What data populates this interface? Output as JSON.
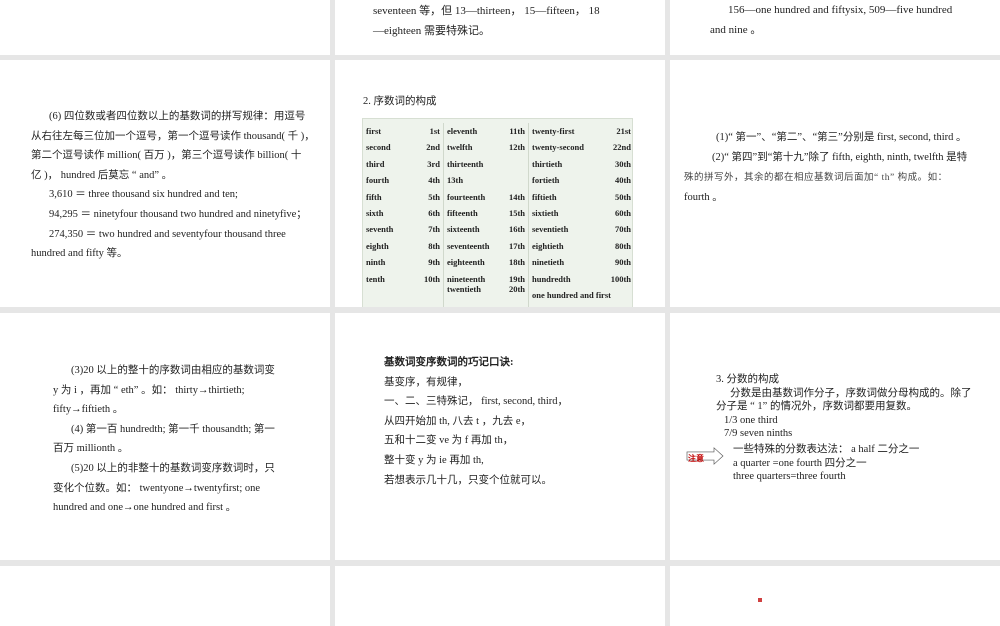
{
  "slide_top_middle": {
    "lines": [
      "seventeen 等，但 13—thirteen， 15—fifteen， 18",
      "—eighteen 需要特殊记。"
    ]
  },
  "slide_top_right": {
    "lines": [
      "156—one hundred and fiftysix, 509—five hundred",
      "and nine 。"
    ]
  },
  "slide_cardinal_rules": {
    "lines": [
      "(6) 四位数或者四位数以上的基数词的拼写规律：用逗号",
      "从右往左每三位加一个逗号，第一个逗号读作 thousand( 千 )，",
      "第二个逗号读作 million( 百万 )，第三个逗号读作 billion( 十",
      "亿 )， hundred 后莫忘 “ and” 。",
      "3,610 ＝ three thousand six hundred and ten;",
      "94,295 ＝ ninetyfour thousand two hundred and ninetyfive；",
      "274,350 ＝ two hundred and seventyfour thousand three",
      "hundred and fifty 等。"
    ]
  },
  "slide_ordinal_table": {
    "title": "2. 序数词的构成",
    "col1": [
      [
        "first",
        "1st"
      ],
      [
        "second",
        "2nd"
      ],
      [
        "third",
        "3rd"
      ],
      [
        "fourth",
        "4th"
      ],
      [
        "fifth",
        "5th"
      ],
      [
        "sixth",
        "6th"
      ],
      [
        "seventh",
        "7th"
      ],
      [
        "eighth",
        "8th"
      ],
      [
        "ninth",
        "9th"
      ],
      [
        "tenth",
        "10th"
      ]
    ],
    "col2": [
      [
        "eleventh",
        "11th"
      ],
      [
        "twelfth",
        "12th"
      ],
      [
        "thirteenth",
        ""
      ],
      [
        "13th",
        ""
      ],
      [
        "fourteenth",
        "14th"
      ],
      [
        "fifteenth",
        "15th"
      ],
      [
        "sixteenth",
        "16th"
      ],
      [
        "seventeenth",
        "17th"
      ],
      [
        "eighteenth",
        "18th"
      ],
      [
        "nineteenth",
        "19th"
      ],
      [
        "twentieth",
        "20th"
      ]
    ],
    "col3": [
      [
        "twenty-first",
        "21st"
      ],
      [
        "twenty-second",
        "22nd"
      ],
      [
        "thirtieth",
        "30th"
      ],
      [
        "fortieth",
        "40th"
      ],
      [
        "fiftieth",
        "50th"
      ],
      [
        "sixtieth",
        "60th"
      ],
      [
        "seventieth",
        "70th"
      ],
      [
        "eightieth",
        "80th"
      ],
      [
        "ninetieth",
        "90th"
      ],
      [
        "hundredth",
        "100th"
      ],
      [
        "one hundred and first",
        ""
      ]
    ]
  },
  "slide_ordinal_rules": {
    "lines": [
      "(1)“ 第一”、“第二”、“第三”分别是  first, second, third 。",
      "(2)“ 第四”到“第十九”除了 fifth, eighth, ninth, twelfth 是特",
      "殊的拼写外，其余的都在相应基数词后面加“    th” 构成。如：",
      "fourth 。"
    ]
  },
  "slide_rules_3_5": {
    "lines": [
      "(3)20 以上的整十的序数词由相应的基数词变",
      "y 为 i ，再加 “ eth” 。如： thirty→thirtieth;",
      "fifty→fiftieth 。",
      "(4) 第一百 hundredth;  第一千 thousandth;  第一",
      "百万 millionth 。",
      "(5)20 以上的非整十的基数词变序数词时，只",
      "变化个位数。如： twentyone→twentyfirst; one",
      "hundred and one→one hundred and first 。"
    ]
  },
  "slide_mnemonic": {
    "title": "基数词变序数词的巧记口诀:",
    "lines": [
      "基变序，有规律，",
      "一、二、三特殊记，    first, second, third，",
      "从四开始加 th, 八去 t ，九去 e，",
      "五和十二变 ve 为 f 再加 th，",
      "整十变 y 为 ie 再加 th,",
      "若想表示几十几，只变个位就可以。"
    ]
  },
  "slide_fractions": {
    "title": "3. 分数的构成",
    "lines": [
      "分数是由基数词作分子，序数词做分母构成的。除了",
      "分子是 “ 1” 的情况外，序数词都要用复数。",
      "1/3  one  third",
      "7/9  seven  ninths"
    ],
    "note_label": "注意",
    "note_lines": [
      "一些特殊的分数表达法： a half    二分之一",
      "a quarter  =one  fourth   四分之一",
      "three quarters=three fourth"
    ]
  },
  "colors": {
    "background": "#e6e6e6",
    "table_bg": "#eef3ec",
    "note_red": "#c00000"
  }
}
